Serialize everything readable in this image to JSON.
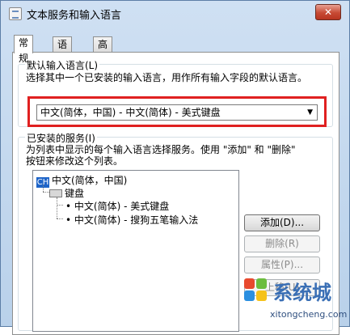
{
  "window": {
    "title": "文本服务和输入语言",
    "close_label": "✕"
  },
  "tabs": [
    {
      "label": "常规",
      "active": true
    },
    {
      "label": "语言栏",
      "active": false
    },
    {
      "label": "高级键设置",
      "active": false
    }
  ],
  "default_language": {
    "group_label": "默认输入语言(L)",
    "description": "选择其中一个已安装的输入语言，用作所有输入字段的默认语言。",
    "selected_value": "中文(简体，中国) - 中文(简体) - 美式键盘"
  },
  "installed_services": {
    "group_label": "已安装的服务(I)",
    "description_line1": "为列表中显示的每个输入语言选择服务。使用 \"添加\" 和 \"删除\"",
    "description_line2": "按钮来修改这个列表。",
    "tree": {
      "language_badge": "CH",
      "language": "中文(简体，中国)",
      "category": "键盘",
      "items": [
        "中文(简体) - 美式键盘",
        "中文(简体) - 搜狗五笔输入法"
      ]
    },
    "buttons": {
      "add": "添加(D)...",
      "remove": "删除(R)",
      "properties": "属性(P)...",
      "move_up": "上移(U)"
    }
  },
  "watermark": {
    "text": "系统城",
    "url": "xitongcheng.com"
  },
  "colors": {
    "highlight_border": "#e02020",
    "title_bar": "#c6dbf1",
    "close_button": "#c74a34"
  }
}
